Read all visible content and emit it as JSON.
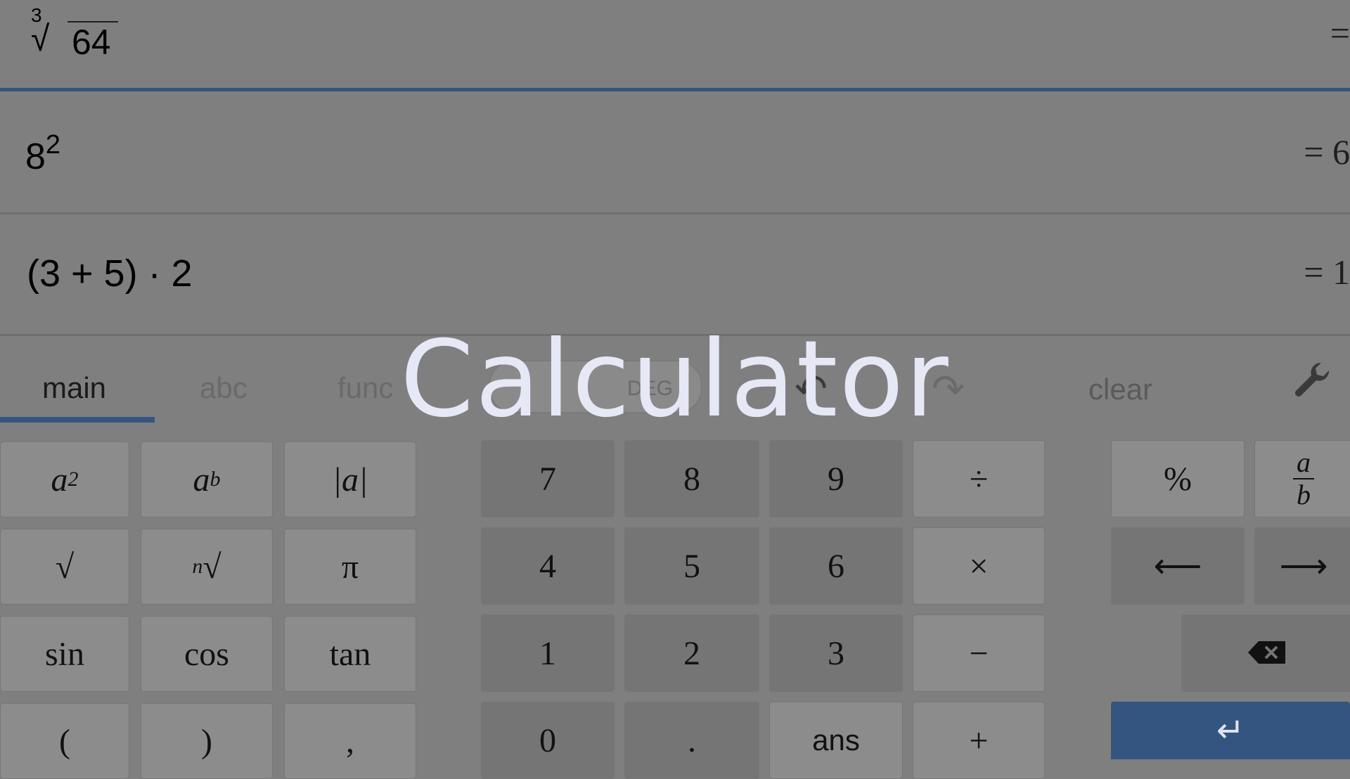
{
  "title": "Calculator",
  "history": [
    {
      "index": "3",
      "radicand": "64",
      "result": "="
    },
    {
      "base": "8",
      "exponent": "2",
      "result": "= 6"
    },
    {
      "expression": "(3 + 5) · 2",
      "result": "= 1"
    }
  ],
  "toolbar": {
    "tabs": [
      "main",
      "abc",
      "func"
    ],
    "active_tab": "main",
    "angle_mode": "DEG",
    "undo_icon": "undo-arrow-icon",
    "redo_icon": "redo-arrow-icon",
    "clear_label": "clear",
    "settings_icon": "wrench-icon"
  },
  "keys": {
    "square": {
      "base": "a",
      "exp": "2"
    },
    "power": {
      "base": "a",
      "exp": "b"
    },
    "abs": "|a|",
    "sqrt": "√",
    "nroot": {
      "index": "n",
      "sym": "√"
    },
    "pi": "π",
    "sin": "sin",
    "cos": "cos",
    "tan": "tan",
    "lparen": "(",
    "rparen": ")",
    "comma": ",",
    "digits": [
      "7",
      "8",
      "9",
      "4",
      "5",
      "6",
      "1",
      "2",
      "3",
      "0"
    ],
    "dot": ".",
    "ans": "ans",
    "divide": "÷",
    "times": "×",
    "minus": "−",
    "plus": "+",
    "percent": "%",
    "fraction": {
      "num": "a",
      "den": "b"
    },
    "left": "⟵",
    "right": "⟶",
    "backspace_icon": "backspace-icon",
    "enter": "↵"
  },
  "colors": {
    "accent": "#34557f",
    "background": "#7f7f7f",
    "overlay_text": "#e6e8f6"
  }
}
